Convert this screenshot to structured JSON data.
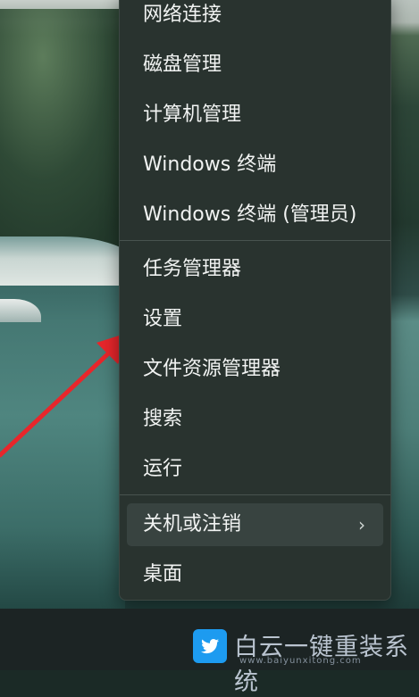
{
  "menu": {
    "items": [
      {
        "label": "网络连接"
      },
      {
        "label": "磁盘管理"
      },
      {
        "label": "计算机管理"
      },
      {
        "label": "Windows 终端"
      },
      {
        "label": "Windows 终端 (管理员)"
      },
      {
        "label": "任务管理器"
      },
      {
        "label": "设置"
      },
      {
        "label": "文件资源管理器"
      },
      {
        "label": "搜索"
      },
      {
        "label": "运行"
      },
      {
        "label": "关机或注销",
        "submenu": true
      },
      {
        "label": "桌面"
      }
    ]
  },
  "watermark": {
    "text": "白云一键重装系统",
    "url": "www.baiyunxitong.com",
    "logo_icon": "twitter-bird-icon"
  },
  "colors": {
    "menu_bg": "#29332f",
    "menu_text": "#f1f3f2",
    "arrow": "#e8262b",
    "watermark_logo": "#1d9bf0"
  }
}
